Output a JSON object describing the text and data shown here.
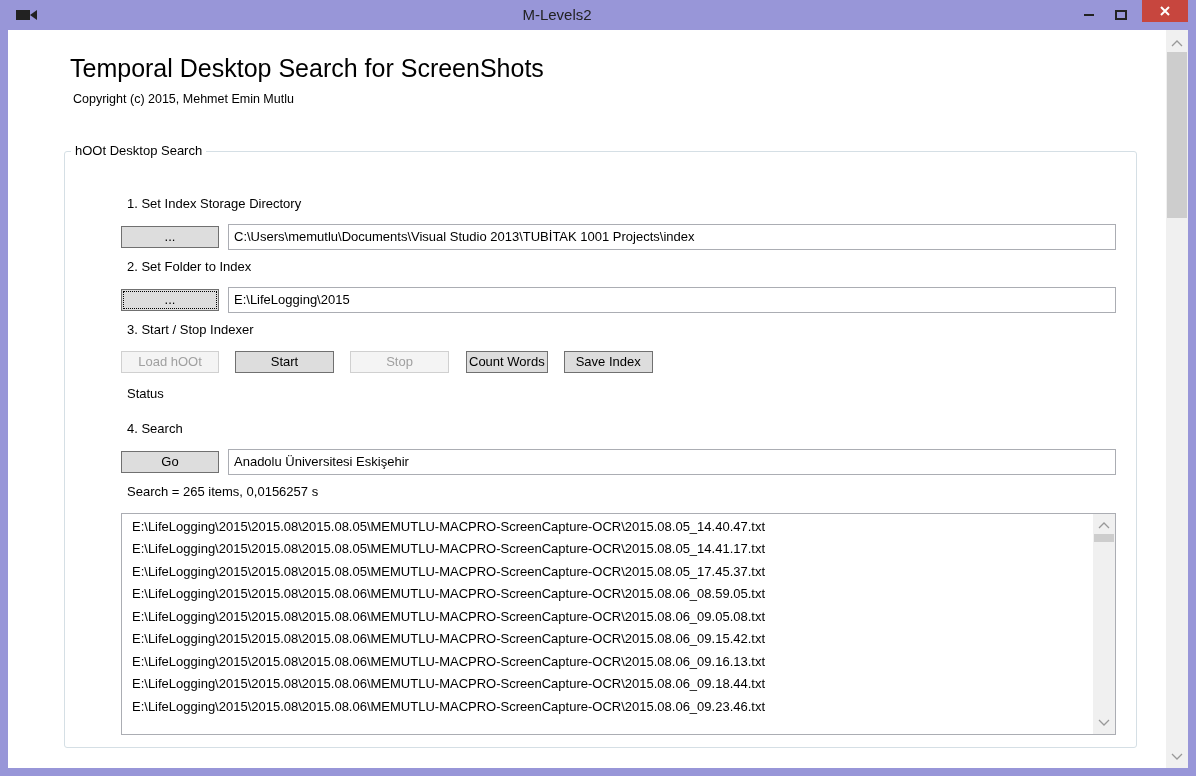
{
  "window": {
    "title": "M-Levels2"
  },
  "header": {
    "title": "Temporal Desktop Search for ScreenShots",
    "copyright": "Copyright (c) 2015, Mehmet Emin Mutlu"
  },
  "group": {
    "legend": "hOOt Desktop Search"
  },
  "steps": [
    {
      "label": "1. Set Index Storage Directory",
      "kind": "path",
      "button": {
        "label": "...",
        "disabled": false,
        "focused": false
      },
      "value": "C:\\Users\\memutlu\\Documents\\Visual Studio 2013\\TUBİTAK 1001 Projects\\index"
    },
    {
      "label": "2. Set Folder to Index",
      "kind": "path",
      "button": {
        "label": "...",
        "disabled": false,
        "focused": true
      },
      "value": "E:\\LifeLogging\\2015"
    },
    {
      "label": "3. Start / Stop Indexer",
      "kind": "buttons",
      "buttons": [
        {
          "label": "Load hOOt",
          "disabled": true,
          "focused": false
        },
        {
          "label": "Start",
          "disabled": false,
          "focused": false
        },
        {
          "label": "Stop",
          "disabled": true,
          "focused": false
        },
        {
          "label": "Count Words",
          "disabled": false,
          "focused": false
        },
        {
          "label": "Save Index",
          "disabled": false,
          "focused": false
        }
      ],
      "status": "Status"
    },
    {
      "label": "4. Search",
      "kind": "path",
      "button": {
        "label": "Go",
        "disabled": false,
        "focused": false
      },
      "value": "Anadolu Üniversitesi Eskişehir"
    }
  ],
  "search_result": "Search = 265 items, 0,0156257 s",
  "results": [
    "E:\\LifeLogging\\2015\\2015.08\\2015.08.05\\MEMUTLU-MACPRO-ScreenCapture-OCR\\2015.08.05_14.40.47.txt",
    "E:\\LifeLogging\\2015\\2015.08\\2015.08.05\\MEMUTLU-MACPRO-ScreenCapture-OCR\\2015.08.05_14.41.17.txt",
    "E:\\LifeLogging\\2015\\2015.08\\2015.08.05\\MEMUTLU-MACPRO-ScreenCapture-OCR\\2015.08.05_17.45.37.txt",
    "E:\\LifeLogging\\2015\\2015.08\\2015.08.06\\MEMUTLU-MACPRO-ScreenCapture-OCR\\2015.08.06_08.59.05.txt",
    "E:\\LifeLogging\\2015\\2015.08\\2015.08.06\\MEMUTLU-MACPRO-ScreenCapture-OCR\\2015.08.06_09.05.08.txt",
    "E:\\LifeLogging\\2015\\2015.08\\2015.08.06\\MEMUTLU-MACPRO-ScreenCapture-OCR\\2015.08.06_09.15.42.txt",
    "E:\\LifeLogging\\2015\\2015.08\\2015.08.06\\MEMUTLU-MACPRO-ScreenCapture-OCR\\2015.08.06_09.16.13.txt",
    "E:\\LifeLogging\\2015\\2015.08\\2015.08.06\\MEMUTLU-MACPRO-ScreenCapture-OCR\\2015.08.06_09.18.44.txt",
    "E:\\LifeLogging\\2015\\2015.08\\2015.08.06\\MEMUTLU-MACPRO-ScreenCapture-OCR\\2015.08.06_09.23.46.txt"
  ]
}
